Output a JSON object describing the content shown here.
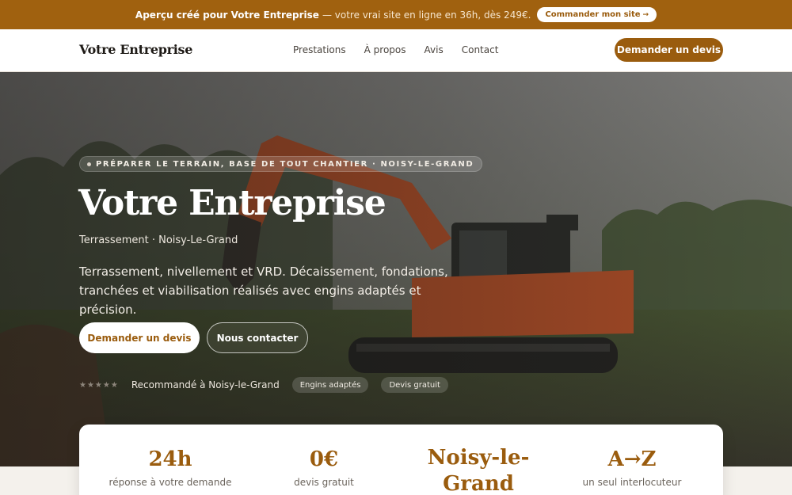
{
  "promo": {
    "bold": "Aperçu créé pour Votre Entreprise",
    "rest": "— votre vrai site en ligne en 36h, dès 249€.",
    "cta": "Commander mon site",
    "cta_arrow": "→"
  },
  "nav": {
    "brand": "Votre Entreprise",
    "links": [
      "Prestations",
      "À propos",
      "Avis",
      "Contact"
    ],
    "cta": "Demander un devis"
  },
  "hero": {
    "eyebrow": "PRÉPARER LE TERRAIN, BASE DE TOUT CHANTIER · NOISY-LE-GRAND",
    "title": "Votre Entreprise",
    "subtitle": "Terrassement · Noisy-Le-Grand",
    "description": "Terrassement, nivellement et VRD. Décaissement, fondations, tranchées et viabilisation réalisés avec engins adaptés et précision.",
    "primary_cta": "Demander un devis",
    "secondary_cta": "Nous contacter",
    "stars": "★★★★★",
    "recommended": "Recommandé à Noisy-le-Grand",
    "chips": [
      "Engins adaptés",
      "Devis gratuit"
    ]
  },
  "stats": [
    {
      "value": "24h",
      "label": "réponse à votre demande"
    },
    {
      "value": "0€",
      "label": "devis gratuit"
    },
    {
      "value": "Noisy-le-Grand",
      "label": ""
    },
    {
      "value": "A→Z",
      "label": "un seul interlocuteur"
    }
  ],
  "colors": {
    "brand": "#9a5c0e",
    "promo_bg": "#a0610f",
    "excavator": "#c0552b"
  },
  "icons": {
    "hero_background": "excavator-photo"
  }
}
